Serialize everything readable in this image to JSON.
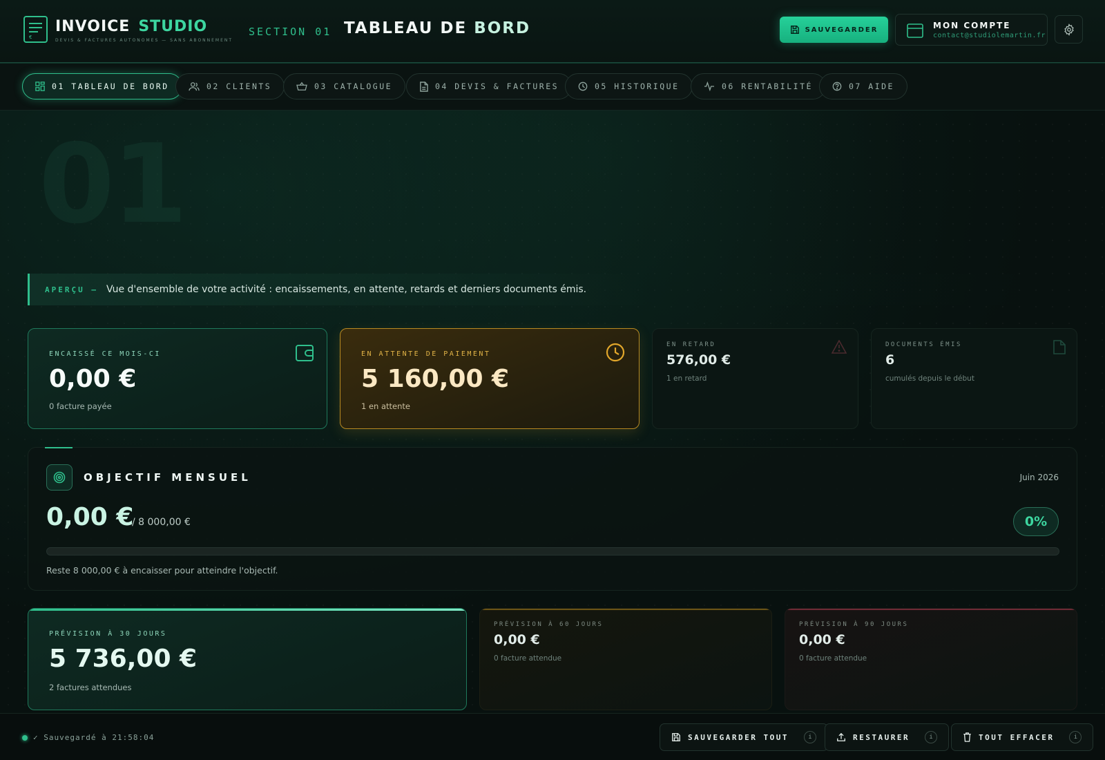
{
  "header": {
    "brand_part1": "INVOICE",
    "brand_part2": "STUDIO",
    "brand_sub": "DEVIS & FACTURES AUTONOMES — SANS ABONNEMENT",
    "section_label": "SECTION 01",
    "section_title_part1": "TABLEAU DE",
    "section_title_part2": "BORD",
    "save_label": "SAUVEGARDER",
    "account_name": "MON COMPTE",
    "account_email": "contact@studiolemartin.fr",
    "logo_euro": "€"
  },
  "nav": {
    "tabs": [
      {
        "label": "01  TABLEAU DE BORD",
        "icon": "dashboard-icon"
      },
      {
        "label": "02  CLIENTS",
        "icon": "users-icon"
      },
      {
        "label": "03  CATALOGUE",
        "icon": "basket-icon"
      },
      {
        "label": "04  DEVIS & FACTURES",
        "icon": "document-icon"
      },
      {
        "label": "05  HISTORIQUE",
        "icon": "clock-icon"
      },
      {
        "label": "06  RENTABILITÉ",
        "icon": "activity-icon"
      },
      {
        "label": "07  AIDE",
        "icon": "help-icon"
      }
    ]
  },
  "big_number": "01",
  "apercu": {
    "label": "APERÇU —",
    "text": "Vue d'ensemble de votre activité : encaissements, en attente, retards et derniers documents émis."
  },
  "stats": {
    "encaisse": {
      "label": "ENCAISSÉ CE MOIS-CI",
      "value": "0,00 €",
      "sub": "0 facture payée",
      "icon": "wallet-icon"
    },
    "attente": {
      "label": "EN ATTENTE DE PAIEMENT",
      "value": "5 160,00 €",
      "sub": "1 en attente",
      "icon": "clock-icon"
    },
    "retard": {
      "label": "EN RETARD",
      "value": "576,00 €",
      "sub": "1 en retard",
      "icon": "warning-icon"
    },
    "documents": {
      "label": "DOCUMENTS ÉMIS",
      "value": "6",
      "sub": "cumulés depuis le début",
      "icon": "file-icon"
    }
  },
  "objectif": {
    "title": "OBJECTIF MENSUEL",
    "month": "Juin 2026",
    "amount": "0,00 €",
    "target": "/ 8 000,00 €",
    "percent_label": "0%",
    "progress_fraction": 0,
    "rest": "Reste 8 000,00 € à encaisser pour atteindre l'objectif."
  },
  "forecast": {
    "d30": {
      "label": "PRÉVISION À 30 JOURS",
      "value": "5 736,00 €",
      "sub": "2 factures attendues"
    },
    "d60": {
      "label": "PRÉVISION À 60 JOURS",
      "value": "0,00 €",
      "sub": "0 facture attendue"
    },
    "d90": {
      "label": "PRÉVISION À 90 JOURS",
      "value": "0,00 €",
      "sub": "0 facture attendue"
    }
  },
  "footer": {
    "status": "✓ Sauvegardé à 21:58:04",
    "save_all": "SAUVEGARDER TOUT",
    "restore": "RESTAURER",
    "clear_all": "TOUT EFFACER",
    "info": "i"
  },
  "colors": {
    "accent": "#2fbf8c",
    "warning": "#e2b447",
    "background": "#08110f"
  }
}
